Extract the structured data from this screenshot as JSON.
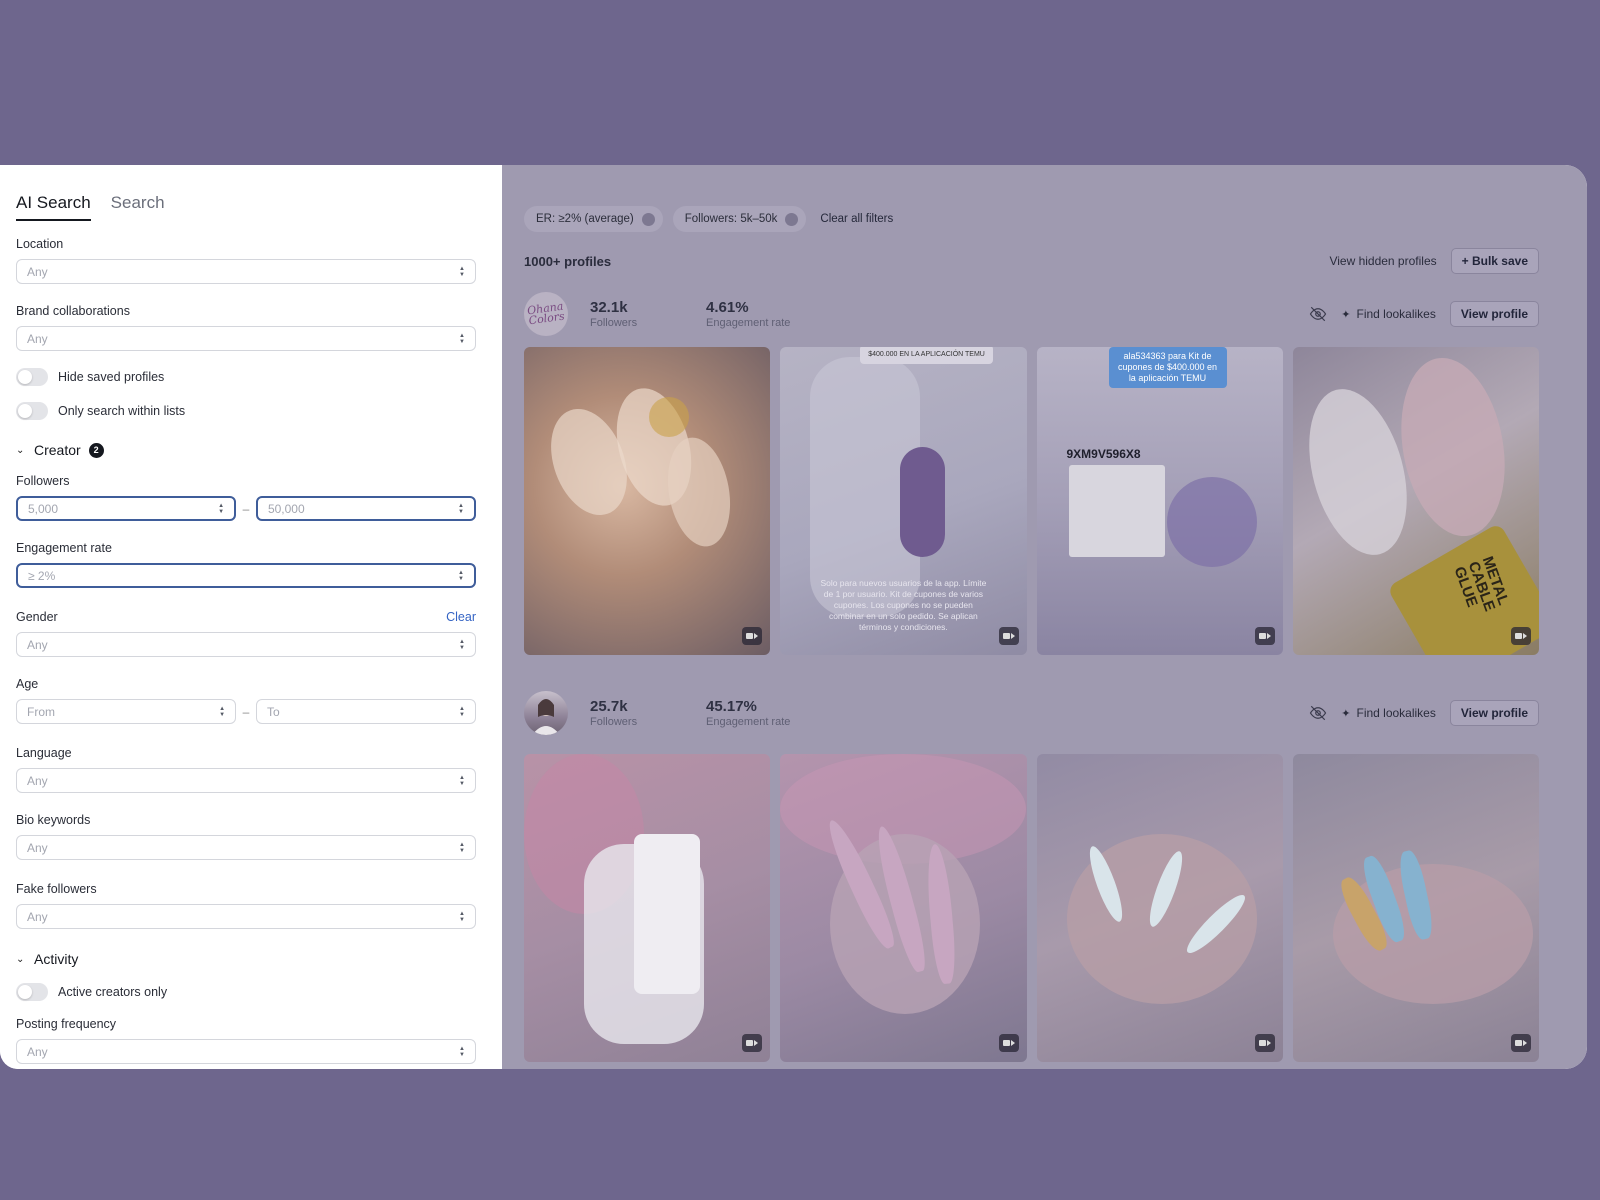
{
  "tabs": [
    {
      "label": "AI Search",
      "active": true
    },
    {
      "label": "Search",
      "active": false
    }
  ],
  "filters": {
    "location": {
      "label": "Location",
      "placeholder": "Any"
    },
    "brand_collaborations": {
      "label": "Brand collaborations",
      "placeholder": "Any"
    },
    "hide_saved_profiles": {
      "label": "Hide saved profiles",
      "on": false
    },
    "only_search_within_lists": {
      "label": "Only search within lists",
      "on": false
    },
    "creator_section": {
      "title": "Creator",
      "badge": "2"
    },
    "followers": {
      "label": "Followers",
      "min": "5,000",
      "max": "50,000",
      "separator": "–"
    },
    "engagement_rate": {
      "label": "Engagement rate",
      "value": "≥ 2%"
    },
    "gender": {
      "label": "Gender",
      "clear": "Clear",
      "placeholder": "Any"
    },
    "age": {
      "label": "Age",
      "from_placeholder": "From",
      "to_placeholder": "To",
      "separator": "–"
    },
    "language": {
      "label": "Language",
      "placeholder": "Any"
    },
    "bio_keywords": {
      "label": "Bio keywords",
      "placeholder": "Any"
    },
    "fake_followers": {
      "label": "Fake followers",
      "placeholder": "Any"
    },
    "activity_section": {
      "title": "Activity"
    },
    "active_creators_only": {
      "label": "Active creators only",
      "on": false
    },
    "posting_frequency": {
      "label": "Posting frequency",
      "placeholder": "Any"
    }
  },
  "active_chips": [
    {
      "label": "ER: ≥2% (average)"
    },
    {
      "label": "Followers: 5k–50k"
    }
  ],
  "clear_all_label": "Clear all filters",
  "results": {
    "count_label": "1000+ profiles",
    "view_hidden_label": "View hidden profiles",
    "bulk_save_label": "+ Bulk save"
  },
  "profiles": [
    {
      "avatar_text": "Ohana Colors",
      "followers": "32.1k",
      "followers_caption": "Followers",
      "engagement": "4.61%",
      "engagement_caption": "Engagement rate",
      "find_lookalikes": "Find lookalikes",
      "view_profile": "View profile",
      "hide_icon": "eye-off-icon"
    },
    {
      "followers": "25.7k",
      "followers_caption": "Followers",
      "engagement": "45.17%",
      "engagement_caption": "Engagement rate",
      "find_lookalikes": "Find lookalikes",
      "view_profile": "View profile",
      "hide_icon": "eye-off-icon"
    }
  ],
  "tile_texts": {
    "t2_caption": "Solo para nuevos usuarios de la app. Límite de 1 por usuario. Kit de cupones de varios cupones. Los cupones no se pueden combinar en un solo pedido. Se aplican términos y condiciones.",
    "t2_sign": "$400.000 EN LA APLICACIÓN TEMU",
    "t3_tag": "ala534363 para Kit de cupones de $400.000 en la aplicación TEMU",
    "t3_code": "9XM9V596X8",
    "t4_label": "METAL CABLE GLUE"
  },
  "colors": {
    "background": "#6e668d",
    "main_overlay": "#9f9ab0",
    "focus_border": "#3f5d9a",
    "link": "#3564c4"
  }
}
